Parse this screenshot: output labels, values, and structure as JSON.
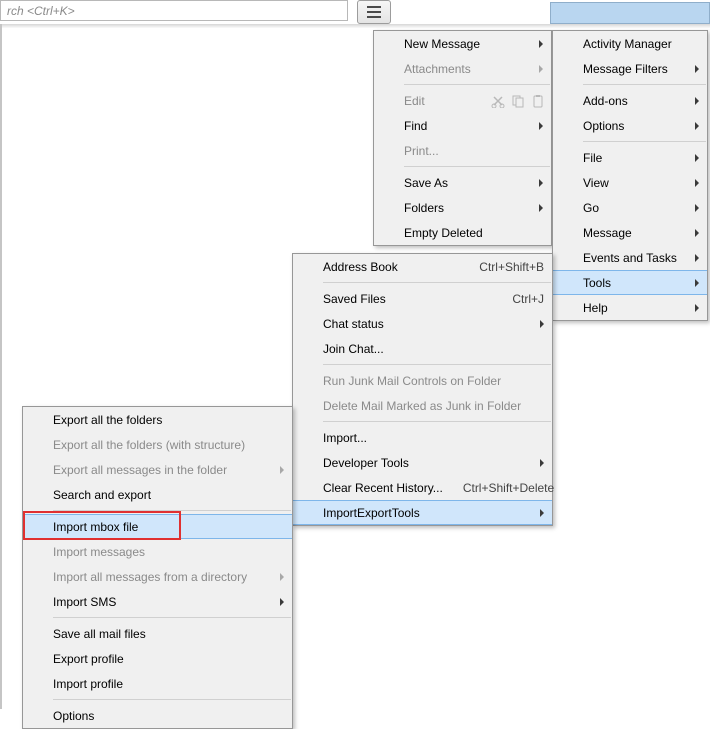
{
  "toolbar": {
    "search_placeholder": "rch <Ctrl+K>",
    "hamburger_name": "app-menu"
  },
  "main_menu": [
    {
      "label": "New Message",
      "arrow": true
    },
    {
      "label": "Attachments",
      "arrow": true,
      "disabled": true
    },
    {
      "sep": true
    },
    {
      "label": "Edit",
      "edit_icons": true,
      "disabled": true
    },
    {
      "label": "Find",
      "arrow": true
    },
    {
      "label": "Print...",
      "disabled": true
    },
    {
      "sep": true
    },
    {
      "label": "Save As",
      "arrow": true
    },
    {
      "label": "Folders",
      "arrow": true
    },
    {
      "label": "Empty Deleted"
    }
  ],
  "right_menu": [
    {
      "label": "Activity Manager"
    },
    {
      "label": "Message Filters",
      "arrow": true
    },
    {
      "sep": true
    },
    {
      "label": "Add-ons",
      "arrow": true
    },
    {
      "label": "Options",
      "arrow": true
    },
    {
      "sep": true
    },
    {
      "label": "File",
      "arrow": true
    },
    {
      "label": "View",
      "arrow": true
    },
    {
      "label": "Go",
      "arrow": true
    },
    {
      "label": "Message",
      "arrow": true
    },
    {
      "label": "Events and Tasks",
      "arrow": true
    },
    {
      "label": "Tools",
      "arrow": true,
      "highlight": true
    },
    {
      "label": "Help",
      "arrow": true
    }
  ],
  "tools_menu": [
    {
      "label": "Address Book",
      "shortcut": "Ctrl+Shift+B"
    },
    {
      "sep": true
    },
    {
      "label": "Saved Files",
      "shortcut": "Ctrl+J"
    },
    {
      "label": "Chat status",
      "arrow": true
    },
    {
      "label": "Join Chat..."
    },
    {
      "sep": true
    },
    {
      "label": "Run Junk Mail Controls on Folder",
      "disabled": true
    },
    {
      "label": "Delete Mail Marked as Junk in Folder",
      "disabled": true
    },
    {
      "sep": true
    },
    {
      "label": "Import..."
    },
    {
      "label": "Developer Tools",
      "arrow": true
    },
    {
      "label": "Clear Recent History...",
      "shortcut": "Ctrl+Shift+Delete"
    },
    {
      "label": "ImportExportTools",
      "arrow": true,
      "highlight": true
    }
  ],
  "import_export_menu": [
    {
      "label": "Export all the folders"
    },
    {
      "label": "Export all the folders (with structure)",
      "disabled": true
    },
    {
      "label": "Export all messages in the folder",
      "arrow": true,
      "disabled": true
    },
    {
      "label": "Search and export"
    },
    {
      "sep": true
    },
    {
      "label": "Import mbox file",
      "highlight": true
    },
    {
      "label": "Import messages",
      "disabled": true
    },
    {
      "label": "Import all messages from a directory",
      "arrow": true,
      "disabled": true
    },
    {
      "label": "Import SMS",
      "arrow": true
    },
    {
      "sep": true
    },
    {
      "label": "Save all mail files"
    },
    {
      "label": "Export profile"
    },
    {
      "label": "Import profile"
    },
    {
      "sep": true
    },
    {
      "label": "Options"
    }
  ]
}
